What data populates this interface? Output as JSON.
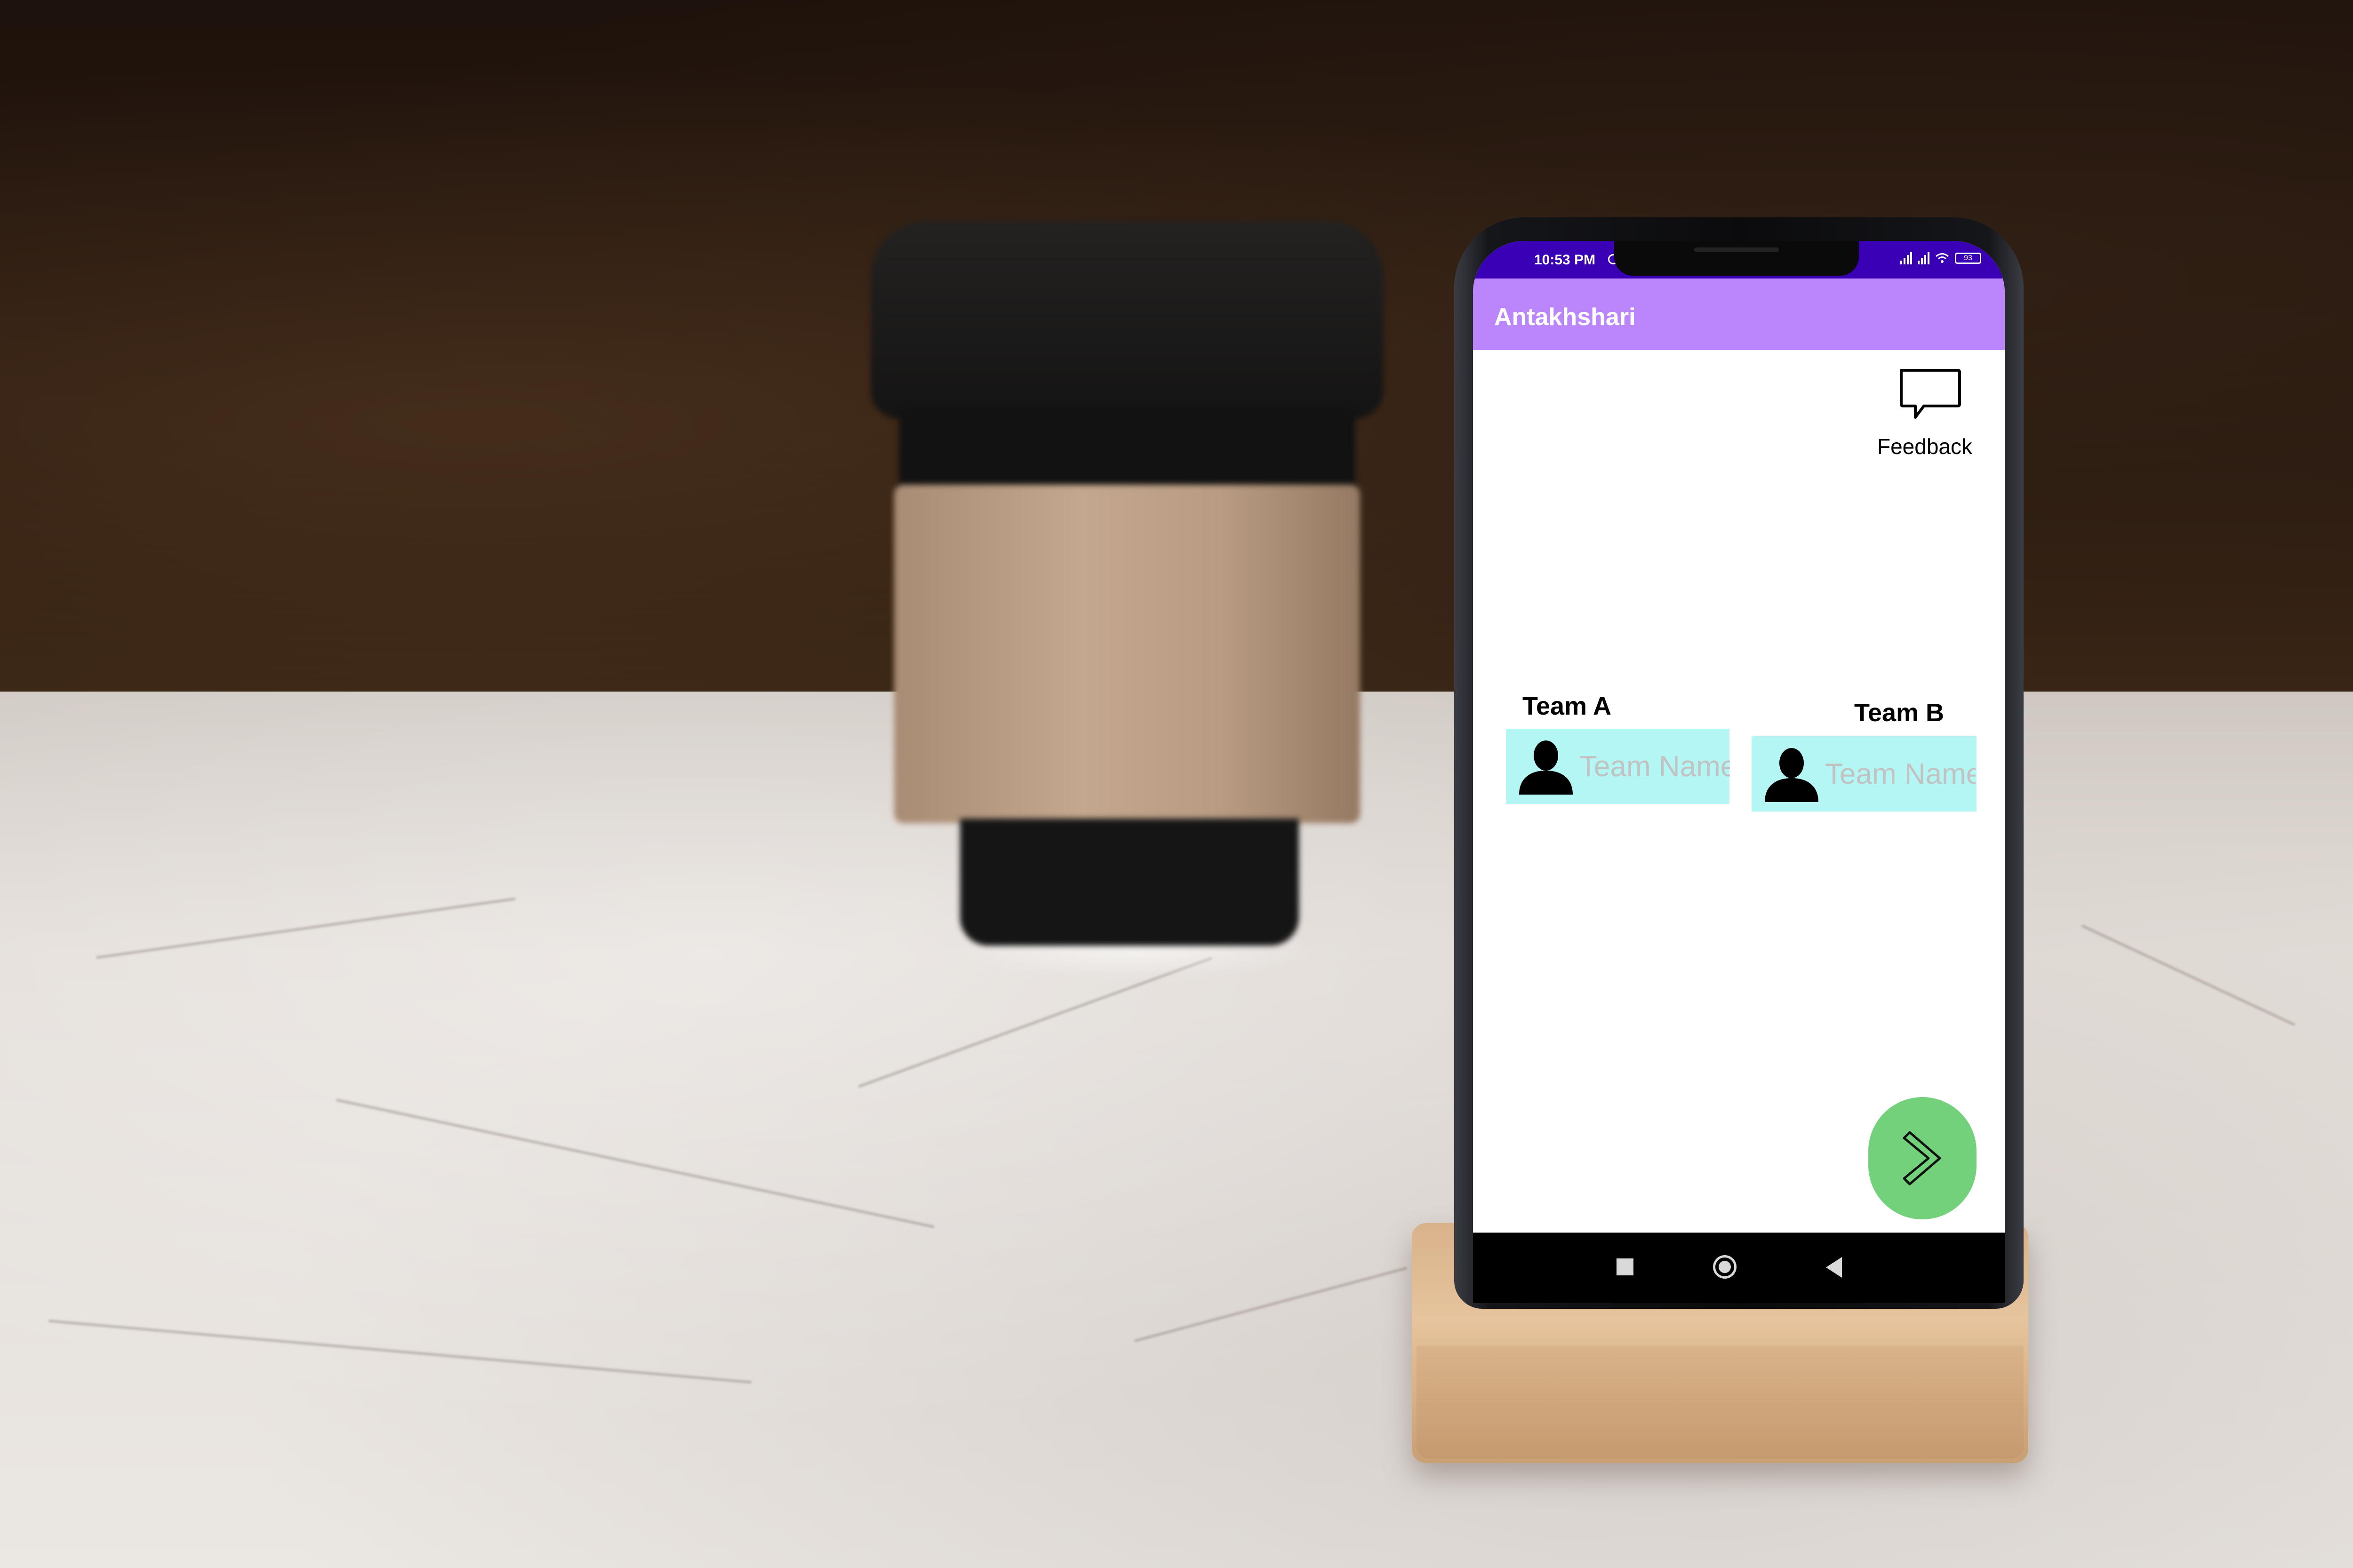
{
  "status_bar": {
    "time": "10:53 PM",
    "battery": "93"
  },
  "app_bar": {
    "title": "Antakhshari",
    "color": "#bb86fc"
  },
  "feedback": {
    "label": "Feedback",
    "icon": "chat-bubble-icon"
  },
  "teams": [
    {
      "label": "Team A",
      "placeholder": "Team Name",
      "icon": "person-silhouette-icon"
    },
    {
      "label": "Team B",
      "placeholder": "Team Name",
      "icon": "person-silhouette-icon"
    }
  ],
  "team_box_color": "#b3f6f3",
  "next_button": {
    "icon": "chevron-right-icon",
    "color": "#72d17a"
  },
  "nav_bar": {
    "icons": [
      "recents-square-icon",
      "home-circle-icon",
      "back-triangle-icon"
    ]
  }
}
